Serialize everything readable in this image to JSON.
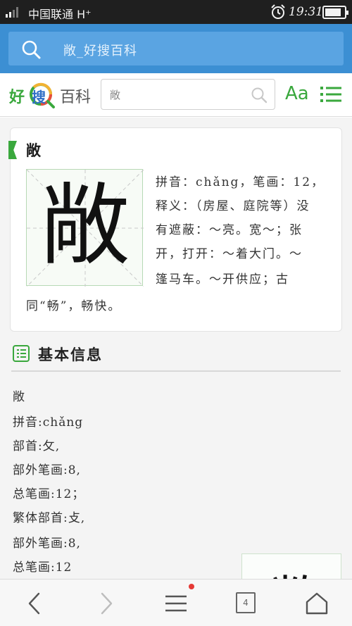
{
  "status_bar": {
    "carrier": "中国联通",
    "network": "H⁺",
    "time": "19:31",
    "battery_level": 0.85
  },
  "browser": {
    "address_text": "敞_好搜百科"
  },
  "site": {
    "logo_hao": "好",
    "logo_sou": "搜",
    "logo_baike": "百科",
    "search_value": "敞",
    "font_button": "Aa"
  },
  "entry": {
    "title": "敞",
    "glyph": "敞",
    "def_lines": [
      "拼音：chǎng，笔画：12，",
      "释义：（房屋、庭院等）没",
      "有遮蔽：～亮。宽～；张",
      "开，打开：～着大门。～",
      "篷马车。～开供应；古",
      "同“畅”，畅快。"
    ]
  },
  "basic_info": {
    "section_title": "基本信息",
    "lines": [
      "敞",
      "拼音:chǎng",
      "部首:攵,",
      "部外笔画:8,",
      "总笔画:12；",
      "繁体部首:攴,",
      "部外笔画:8,",
      "总笔画:12"
    ]
  },
  "bottom_nav": {
    "tab_count": "4"
  },
  "colors": {
    "status_bg": "#1f1f1f",
    "browser_bar": "#3c8fd3",
    "address_box": "#5aa4e2",
    "brand_green": "#3aa83d",
    "brand_blue": "#2f6fc7",
    "notification_dot": "#e53935"
  },
  "icons": {
    "signal": "signal-icon",
    "alarm": "alarm-clock-icon",
    "battery": "battery-icon",
    "search": "search-icon",
    "menu": "list-menu-icon",
    "back": "chevron-left-icon",
    "forward": "chevron-right-icon",
    "tabs": "tabs-icon",
    "home": "home-icon"
  }
}
